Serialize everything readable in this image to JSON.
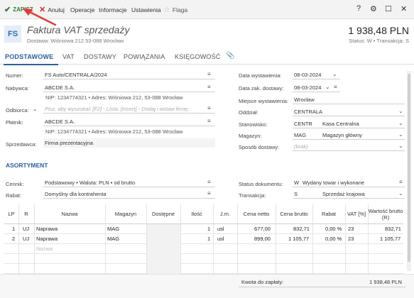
{
  "toolbar": {
    "save": "ZAPISZ",
    "cancel": "Anuluj",
    "operations": "Operacje",
    "information": "Informacje",
    "settings": "Ustawienia",
    "flag": "Flaga"
  },
  "header": {
    "badge": "FS",
    "title": "Faktura VAT sprzedaży",
    "subtitle": "Dostawa: Wiśniowa 212 53-088 Wrocław",
    "amount": "1 938,48 PLN",
    "status": "Status: W • Transakcja: S"
  },
  "tabs": [
    "PODSTAWOWE",
    "VAT",
    "DOSTAWY",
    "POWIĄZANIA",
    "KSIĘGOWOŚĆ"
  ],
  "left_form": {
    "numer_label": "Numer:",
    "numer_value": "FS Auto/CENTRALA/2024",
    "nabywca_label": "Nabywca:",
    "nabywca_value": "ABCDE S.A.",
    "nabywca_info": "NIP: 1234774321  •  Adres: Wiśniowa 212, 53-088 Wrocław",
    "odbiorca_label": "Odbiorca:",
    "odbiorca_placeholder": "Pisz, aby wyszukać [F2] - Lista; [Insert] - Dodaj i wstaw firmę;",
    "platnik_label": "Płatnik:",
    "platnik_value": "ABCDE S.A.",
    "platnik_info": "NIP: 1234774321  •  Adres: Wiśniowa 212, 53-088 Wrocław",
    "sprzedawca_label": "Sprzedawca:",
    "sprzedawca_value": "Firma prezentacyjna"
  },
  "right_form": {
    "data_wyst_label": "Data wystawienia:",
    "data_wyst_value": "08-03-2024",
    "data_dost_label": "Data zak. dostawy:",
    "data_dost_value": "08-03-2024",
    "miejsce_label": "Miejsce wystawienia:",
    "miejsce_value": "Wrocław",
    "oddzial_label": "Oddział:",
    "oddzial_value": "CENTRALA",
    "stanowisko_label": "Stanowisko:",
    "stanowisko_code": "CENTR",
    "stanowisko_name": "Kasa Centralna",
    "magazyn_label": "Magazyn:",
    "magazyn_code": "MAG",
    "magazyn_name": "Magazyn główny",
    "sposob_label": "Sposób dostawy:",
    "sposob_placeholder": "(brak)"
  },
  "assortment": {
    "section_title": "ASORTYMENT",
    "cennik_label": "Cennik:",
    "cennik_value": "Podstawowy • Waluta: PLN • od brutto",
    "rabat_label": "Rabat:",
    "rabat_value": "Domyślny dla kontrahenta",
    "status_label": "Status dokumentu:",
    "status_code": "W",
    "status_name": "Wydany towar i wykonane",
    "transakcja_label": "Transakcja:",
    "transakcja_code": "S",
    "transakcja_name": "Sprzedaż krajowa"
  },
  "table": {
    "headers": [
      "LP",
      "R",
      "Nazwa",
      "Magazyn",
      "Dostępne",
      "Ilość",
      "J.m.",
      "Cena netto",
      "Cena brutto",
      "Rabat",
      "VAT [%]",
      "Wartość brutto (R)"
    ],
    "rows": [
      [
        "1",
        "UJ",
        "Naprawa",
        "MAG",
        "",
        "1",
        "usl",
        "677,00",
        "832,71",
        "0,00 %",
        "23",
        "832,71"
      ],
      [
        "2",
        "UJ",
        "Naprawa",
        "MAG",
        "",
        "1",
        "usl",
        "899,00",
        "1 105,77",
        "0,00 %",
        "23",
        "1 105,77"
      ]
    ],
    "new_row_placeholder": "Nazwa"
  },
  "footer": {
    "label": "Kwota do zapłaty:",
    "value": "1 938,48 PLN"
  },
  "colors": {
    "accent": "#2a5f9e",
    "save_green": "#2e7d32",
    "cancel_red": "#d32f2f",
    "arrow_red": "#e53935"
  }
}
